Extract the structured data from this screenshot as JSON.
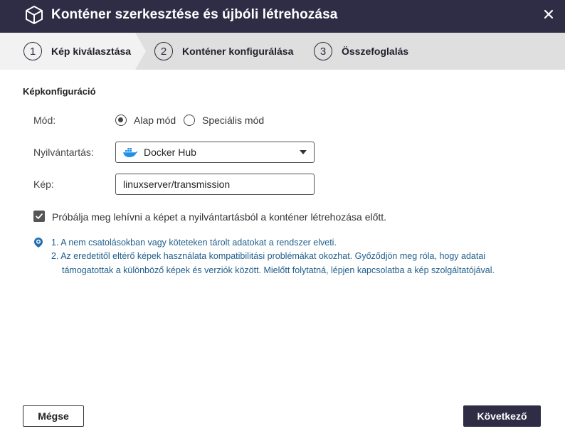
{
  "window": {
    "title": "Konténer szerkesztése és újbóli létrehozása",
    "close_icon": "close-icon"
  },
  "steps": [
    {
      "number": "1",
      "label": "Kép kiválasztása",
      "active": true
    },
    {
      "number": "2",
      "label": "Konténer konfigurálása",
      "active": false
    },
    {
      "number": "3",
      "label": "Összefoglalás",
      "active": false
    }
  ],
  "form": {
    "section_title": "Képkonfiguráció",
    "mode": {
      "label": "Mód:",
      "options": [
        "Alap mód",
        "Speciális mód"
      ],
      "selected": "Alap mód"
    },
    "registry": {
      "label": "Nyilvántartás:",
      "value": "Docker Hub",
      "icon": "docker-icon"
    },
    "image": {
      "label": "Kép:",
      "value": "linuxserver/transmission"
    },
    "pull_checkbox": {
      "label": "Próbálja meg lehívni a képet a nyilvántartásból a konténer létrehozása előtt.",
      "checked": true
    }
  },
  "notes": {
    "icon": "info-icon",
    "line1": "1. A nem csatolásokban vagy köteteken tárolt adatokat a rendszer elveti.",
    "line2": "2. Az eredetitől eltérő képek használata kompatibilitási problémákat okozhat. Győződjön meg róla, hogy adatai",
    "line3": "támogatottak a különböző képek és verziók között. Mielőtt folytatná, lépjen kapcsolatba a kép szolgáltatójával."
  },
  "buttons": {
    "cancel": "Mégse",
    "next": "Következő"
  },
  "colors": {
    "titlebar": "#2f2d45",
    "steps_bg": "#dfdfdf",
    "note_text": "#1f5e8c",
    "docker_blue": "#1d91e6"
  }
}
